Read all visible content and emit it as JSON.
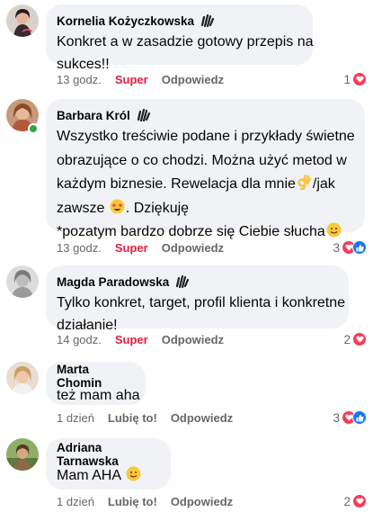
{
  "comments": [
    {
      "author": "Kornelia Kożyczkowska",
      "lines": [
        "Konkret a w zasadzie gotowy przepis na",
        "sukces!!"
      ],
      "time": "13 godz.",
      "reaction_label": "Super",
      "reply_label": "Odpowiedz",
      "reaction_count": "1"
    },
    {
      "author": "Barbara Król",
      "line1": "Wszystko  treściwie podane  i przykłady świetne",
      "line2": "obrazujące o co chodzi. Można użyć metod  w",
      "line3_a": "każdym  biznesie. Rewelacja dla mnie",
      "line3_b": "/jak",
      "line4_a": "zawsze ",
      "line4_b": ". Dziękuję",
      "line5": "*pozatym bardzo dobrze się Ciebie słucha",
      "time": "13 godz.",
      "reaction_label": "Super",
      "reply_label": "Odpowiedz",
      "reaction_count": "3"
    },
    {
      "author": "Magda Paradowska",
      "lines": [
        "Tylko konkret, target, profil klienta i konkretne",
        "działanie!"
      ],
      "time": "14 godz.",
      "reaction_label": "Super",
      "reply_label": "Odpowiedz",
      "reaction_count": "2"
    },
    {
      "author": "Marta Chomin",
      "lines": [
        "też mam aha"
      ],
      "time": "1 dzień",
      "reaction_label": "Lubię to!",
      "reply_label": "Odpowiedz",
      "reaction_count": "3"
    },
    {
      "author": "Adriana Tarnawska",
      "text": "Mam AHA ",
      "time": "1 dzień",
      "reaction_label": "Lubię to!",
      "reply_label": "Odpowiedz",
      "reaction_count": "2"
    }
  ],
  "icons": {
    "badge": "fan-badge-icon",
    "heart": "heart-reaction-icon",
    "like": "like-reaction-icon",
    "ok_hand": "ok-hand-emoji",
    "star_struck": "star-struck-emoji",
    "smile": "smile-emoji"
  },
  "colors": {
    "bubble": "#f0f2f5",
    "super": "#e41e3f",
    "secondary": "#65676b",
    "heart": "#f33e58",
    "like": "#1877f2",
    "online": "#31a24c"
  }
}
